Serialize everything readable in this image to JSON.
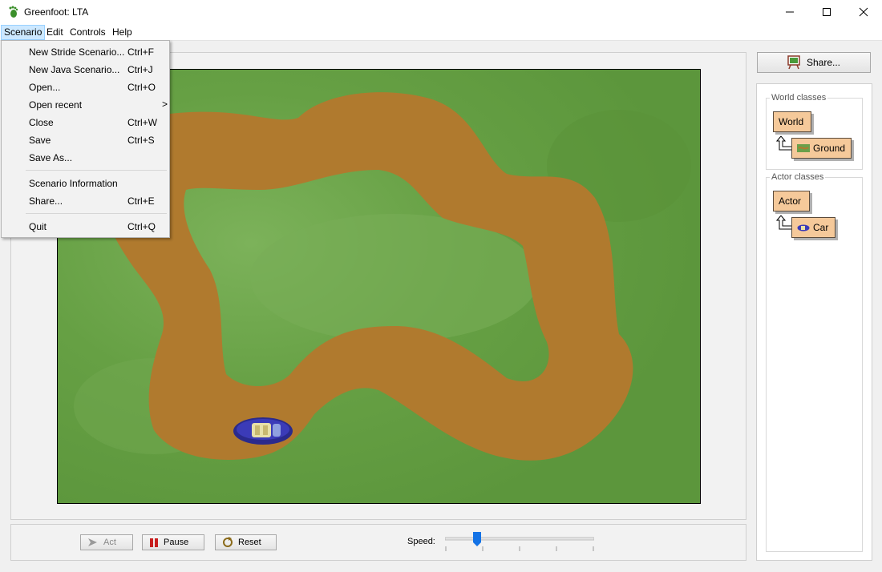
{
  "window": {
    "title": "Greenfoot: LTA"
  },
  "menubar": [
    "Scenario",
    "Edit",
    "Controls",
    "Help"
  ],
  "scenario_menu": {
    "items": [
      {
        "label": "New Stride Scenario...",
        "shortcut": "Ctrl+F"
      },
      {
        "label": "New Java Scenario...",
        "shortcut": "Ctrl+J"
      },
      {
        "label": "Open...",
        "shortcut": "Ctrl+O"
      },
      {
        "label": "Open recent",
        "shortcut": ">"
      },
      {
        "label": "Close",
        "shortcut": "Ctrl+W"
      },
      {
        "label": "Save",
        "shortcut": "Ctrl+S"
      },
      {
        "label": "Save As...",
        "shortcut": ""
      },
      {
        "label": "Scenario Information",
        "shortcut": ""
      },
      {
        "label": "Share...",
        "shortcut": "Ctrl+E"
      },
      {
        "label": "Quit",
        "shortcut": "Ctrl+Q"
      }
    ]
  },
  "controls": {
    "act": "Act",
    "pause": "Pause",
    "reset": "Reset",
    "speed_label": "Speed:",
    "speed_fraction": 0.2
  },
  "sidebar": {
    "share": "Share...",
    "world_classes_title": "World classes",
    "world_classes": [
      "World",
      "Ground"
    ],
    "actor_classes_title": "Actor classes",
    "actor_classes": [
      "Actor",
      "Car"
    ]
  },
  "colors": {
    "grass": "#6aa04a",
    "track": "#b07a2e",
    "class_box": "#f5c99a",
    "menu_highlight": "#cce8ff"
  },
  "icons": [
    "greenfoot-foot-icon",
    "minimize-icon",
    "maximize-icon",
    "close-icon",
    "act-arrow-icon",
    "pause-icon",
    "reset-icon",
    "share-easel-icon",
    "car-icon",
    "ground-icon",
    "inherit-arrow-icon",
    "submenu-arrow-icon"
  ]
}
